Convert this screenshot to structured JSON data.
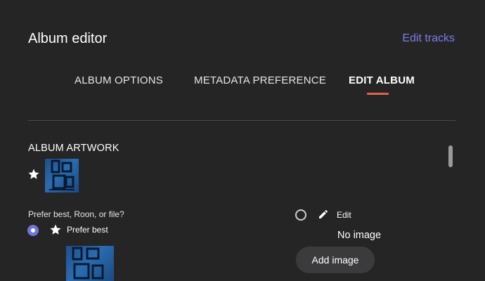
{
  "header": {
    "title": "Album editor",
    "edit_tracks_label": "Edit tracks"
  },
  "tabs": [
    {
      "label": "ALBUM OPTIONS",
      "active": false
    },
    {
      "label": "METADATA PREFERENCE",
      "active": false
    },
    {
      "label": "EDIT ALBUM",
      "active": true
    }
  ],
  "colors": {
    "accent": "#7275d8",
    "tab_underline": "#e0614c",
    "background": "#252526"
  },
  "artwork": {
    "heading": "ALBUM ARTWORK",
    "preference_question": "Prefer best, Roon, or file?",
    "options": [
      {
        "icon": "star-icon",
        "label": "Prefer best",
        "selected": true
      },
      {
        "icon": "pencil-icon",
        "label": "Edit",
        "selected": false
      }
    ],
    "no_image_text": "No image",
    "add_image_label": "Add image"
  }
}
